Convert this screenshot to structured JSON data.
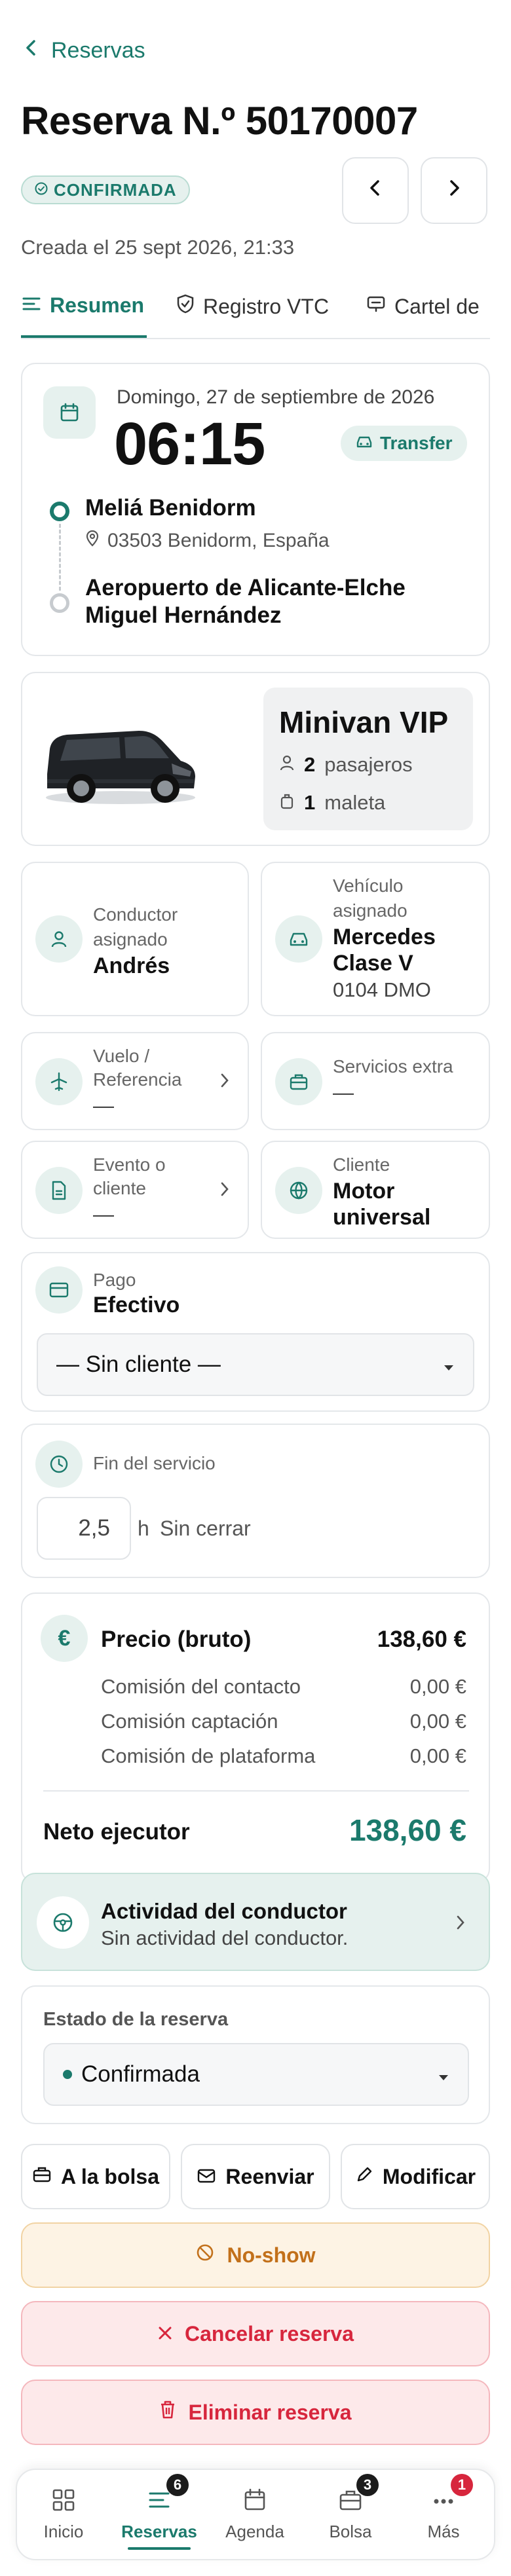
{
  "header": {
    "back_label": "Reservas",
    "title": "Reserva N.º 50170007",
    "status_badge": "CONFIRMADA",
    "created": "Creada el 25 sept 2026, 21:33"
  },
  "tabs": [
    {
      "label": "Resumen",
      "active": true
    },
    {
      "label": "Registro VTC",
      "active": false
    },
    {
      "label": "Cartel de",
      "active": false
    }
  ],
  "trip": {
    "date": "Domingo, 27 de septiembre de 2026",
    "time": "06:15",
    "type": "Transfer",
    "origin_name": "Meliá Benidorm",
    "origin_address": "03503 Benidorm, España",
    "destination_line1": "Aeropuerto de Alicante-Elche",
    "destination_line2": "Miguel Hernández"
  },
  "vehicle_class": {
    "name": "Minivan VIP",
    "passengers_count": "2",
    "passengers_label": "pasajeros",
    "luggage_count": "1",
    "luggage_label": "maleta"
  },
  "driver": {
    "label_line1": "Conductor",
    "label_line2": "asignado",
    "value": "Andrés"
  },
  "vehicle": {
    "label_line1": "Vehículo",
    "label_line2": "asignado",
    "value_line1": "Mercedes",
    "value_line2": "Clase V",
    "plate": "0104 DMO"
  },
  "flight": {
    "label_line1": "Vuelo /",
    "label_line2": "Referencia",
    "value": "—"
  },
  "extras": {
    "label": "Servicios extra",
    "value": "—"
  },
  "event": {
    "label_line1": "Evento o",
    "label_line2": "cliente",
    "value": "—"
  },
  "client": {
    "label": "Cliente",
    "value_line1": "Motor",
    "value_line2": "universal"
  },
  "payment": {
    "label": "Pago",
    "value": "Efectivo",
    "select_value": "— Sin cliente —"
  },
  "service_end": {
    "label": "Fin del servicio",
    "hours_value": "2,5",
    "unit": "h",
    "status": "Sin cerrar"
  },
  "pricing": {
    "title": "Precio (bruto)",
    "gross": "138,60 €",
    "rows": [
      {
        "label": "Comisión del contacto",
        "value": "0,00 €"
      },
      {
        "label": "Comisión captación",
        "value": "0,00 €"
      },
      {
        "label": "Comisión de plataforma",
        "value": "0,00 €"
      }
    ],
    "net_label": "Neto ejecutor",
    "net_value": "138,60 €"
  },
  "driver_activity": {
    "title": "Actividad del conductor",
    "subtitle": "Sin actividad del conductor."
  },
  "reservation_status": {
    "label": "Estado de la reserva",
    "value": "Confirmada"
  },
  "actions": {
    "bolsa": "A la bolsa",
    "resend": "Reenviar",
    "edit": "Modificar",
    "noshow": "No-show",
    "cancel": "Cancelar reserva",
    "delete": "Eliminar reserva"
  },
  "bottom_nav": [
    {
      "label": "Inicio",
      "badge": ""
    },
    {
      "label": "Reservas",
      "badge": "6"
    },
    {
      "label": "Agenda",
      "badge": ""
    },
    {
      "label": "Bolsa",
      "badge": "3"
    },
    {
      "label": "Más",
      "badge": "1"
    }
  ],
  "colors": {
    "accent": "#1b7a6c",
    "accent_light": "#e6f1ee",
    "warning": "#c2701a",
    "danger": "#d7263d"
  }
}
